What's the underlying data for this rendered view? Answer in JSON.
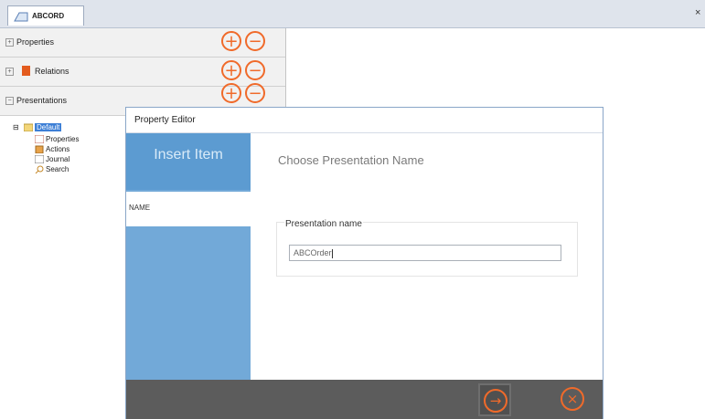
{
  "tab": {
    "title": "ABCORD",
    "close_glyph": "×"
  },
  "sections": [
    {
      "label": "Properties",
      "expander": "+"
    },
    {
      "label": "Relations",
      "expander": "+"
    },
    {
      "label": "Presentations",
      "expander": "−"
    }
  ],
  "buttons": {
    "add_glyph": "+",
    "remove_glyph": "−"
  },
  "tree": {
    "root": "Default",
    "children": [
      "Properties",
      "Actions",
      "Journal",
      "Search"
    ]
  },
  "dialog": {
    "title": "Property Editor",
    "sidebar_heading": "Insert Item",
    "step_label": "NAME",
    "content_title": "Choose Presentation Name",
    "group_label": "Presentation name",
    "input_value": "ABCOrder",
    "next_glyph": "→",
    "cancel_glyph": "×"
  },
  "colors": {
    "accent": "#f06a2a",
    "sidebar": "#72a9d8",
    "footer": "#5c5c5c",
    "selection": "#3d7fd6"
  }
}
